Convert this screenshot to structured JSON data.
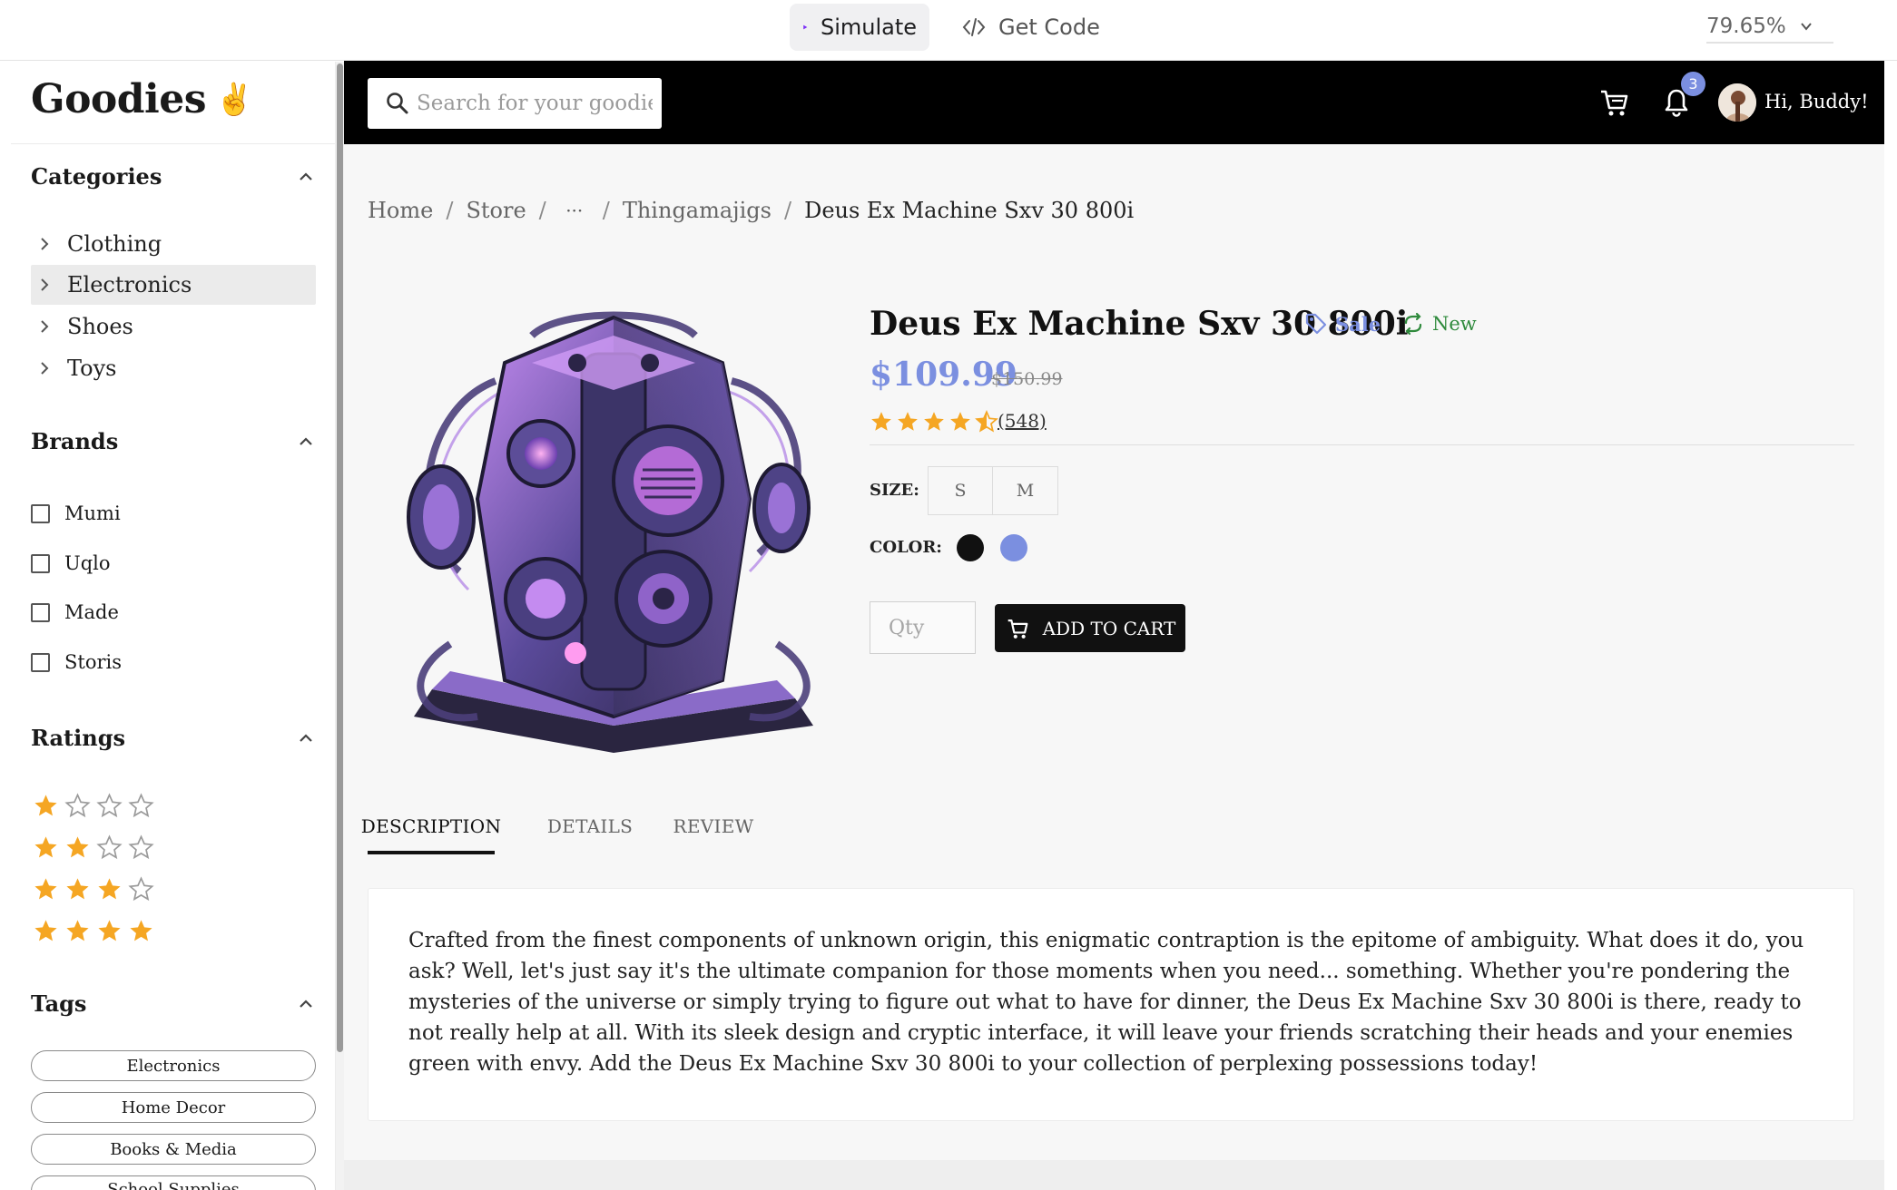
{
  "toolbar": {
    "simulate_label": "Simulate",
    "getcode_label": "Get Code",
    "zoom": "79.65%"
  },
  "sidebar": {
    "logo": "Goodies",
    "logo_emoji": "✌",
    "categories": {
      "title": "Categories",
      "items": [
        {
          "label": "Clothing"
        },
        {
          "label": "Electronics",
          "active": true
        },
        {
          "label": "Shoes"
        },
        {
          "label": "Toys"
        }
      ]
    },
    "brands": {
      "title": "Brands",
      "items": [
        {
          "label": "Mumi",
          "checked": false
        },
        {
          "label": "Uqlo",
          "checked": false
        },
        {
          "label": "Made",
          "checked": false
        },
        {
          "label": "Storis",
          "checked": false
        }
      ]
    },
    "ratings": {
      "title": "Ratings",
      "rows": [
        1,
        2,
        3,
        4
      ]
    },
    "tags": {
      "title": "Tags",
      "items": [
        {
          "label": "Electronics"
        },
        {
          "label": "Home Decor"
        },
        {
          "label": "Books & Media"
        },
        {
          "label": "School Supplies"
        }
      ]
    }
  },
  "header": {
    "search_placeholder": "Search for your goodies",
    "notification_count": "3",
    "greeting": "Hi, Buddy!"
  },
  "breadcrumb": {
    "items": [
      "Home",
      "Store",
      "···",
      "Thingamajigs"
    ],
    "current": "Deus Ex Machine Sxv 30 800i"
  },
  "product": {
    "title": "Deus Ex Machine Sxv 30 800i",
    "sale_label": "Sale",
    "new_label": "New",
    "price": "$109.99",
    "old_price": "$150.99",
    "rating": 4.5,
    "reviews": "(548)",
    "size_label": "SIZE:",
    "sizes": [
      "S",
      "M"
    ],
    "color_label": "COLOR:",
    "colors": [
      "#111111",
      "#7b8fe0"
    ],
    "qty_placeholder": "Qty",
    "add_to_cart": "ADD TO CART"
  },
  "tabs": {
    "items": [
      {
        "label": "DESCRIPTION",
        "active": true
      },
      {
        "label": "DETAILS"
      },
      {
        "label": "REVIEW"
      }
    ]
  },
  "description": "Crafted from the finest components of unknown origin, this enigmatic contraption is the epitome of ambiguity. What does it do, you ask? Well, let's just say it's the ultimate companion for those moments when you need... something. Whether you're pondering the mysteries of the universe or simply trying to figure out what to have for dinner, the Deus Ex Machine Sxv 30 800i is there, ready to not really help at all. With its sleek design and cryptic interface, it will leave your friends scratching their heads and your enemies green with envy. Add the Deus Ex Machine Sxv 30 800i to your collection of perplexing possessions today!",
  "colors": {
    "accent": "#7b8fe0",
    "star": "#f5a623",
    "header_bg": "#000000",
    "new_green": "#2f8a3c"
  }
}
